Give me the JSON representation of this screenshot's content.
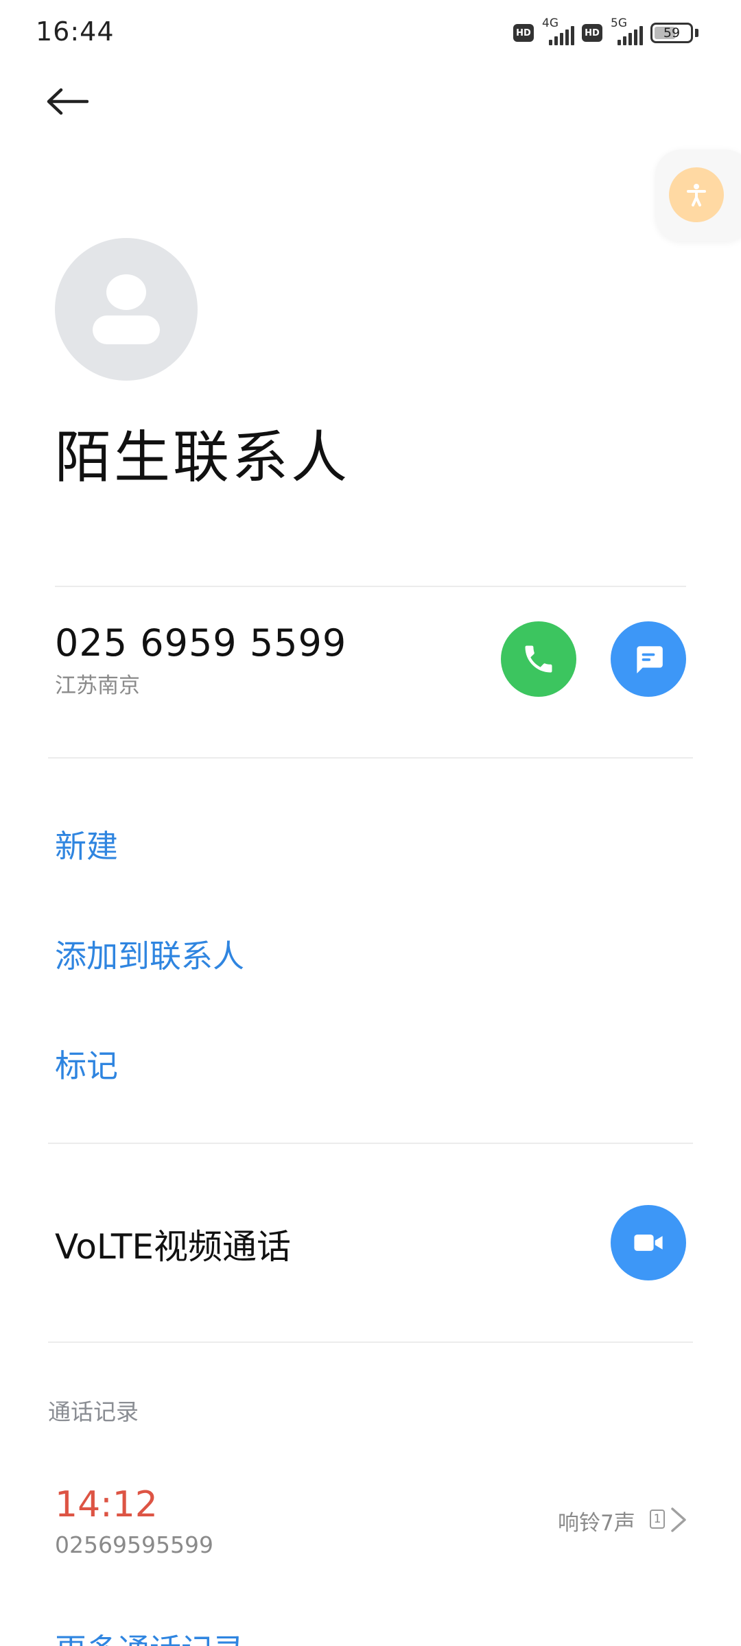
{
  "status_bar": {
    "time": "16:44",
    "sim1": {
      "hd": "HD",
      "network": "4G"
    },
    "sim2": {
      "hd": "HD",
      "network": "5G"
    },
    "battery": "59",
    "battery_level_percent": 59
  },
  "contact": {
    "name": "陌生联系人",
    "phone": "025 6959 5599",
    "location": "江苏南京"
  },
  "actions": {
    "new": "新建",
    "add_to_contacts": "添加到联系人",
    "mark": "标记"
  },
  "volte": {
    "label": "VoLTE视频通话"
  },
  "call_log": {
    "section_title": "通话记录",
    "entries": [
      {
        "time": "14:12",
        "number": "02569595599",
        "detail": "响铃7声",
        "sim": "1"
      }
    ],
    "more_label": "更多通话记录"
  },
  "colors": {
    "accent": "#2f85e0",
    "call_green": "#3cc55f",
    "action_blue": "#3d97f7",
    "missed_red": "#dd5444",
    "accessibility_orange": "#ffd9a3"
  },
  "icons": {
    "back": "arrow-left-icon",
    "call": "phone-icon",
    "message": "message-icon",
    "video": "video-camera-icon",
    "accessibility": "accessibility-icon",
    "avatar": "person-icon",
    "chevron": "chevron-right-icon"
  }
}
